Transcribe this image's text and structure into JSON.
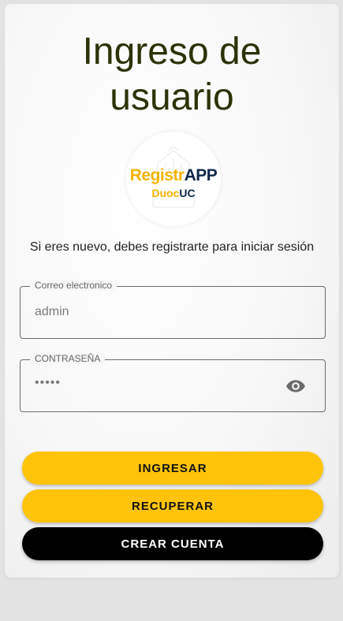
{
  "page": {
    "title_line1": "Ingreso de",
    "title_line2": "usuario"
  },
  "logo": {
    "main_part1": "Registr",
    "main_part2": "APP",
    "sub_part1": "Duoc",
    "sub_part2": "UC"
  },
  "hint": "Si eres nuevo, debes registrarte para iniciar sesión",
  "email_field": {
    "label": "Correo electronico",
    "value": "admin"
  },
  "password_field": {
    "label": "CONTRASEÑA",
    "value": "•••••",
    "toggle_icon": "eye-icon"
  },
  "buttons": {
    "login": "INGRESAR",
    "recover": "RECUPERAR",
    "create": "CREAR CUENTA"
  },
  "colors": {
    "accent_yellow": "#ffc409",
    "title": "#2b3307",
    "create_bg": "#000000"
  }
}
